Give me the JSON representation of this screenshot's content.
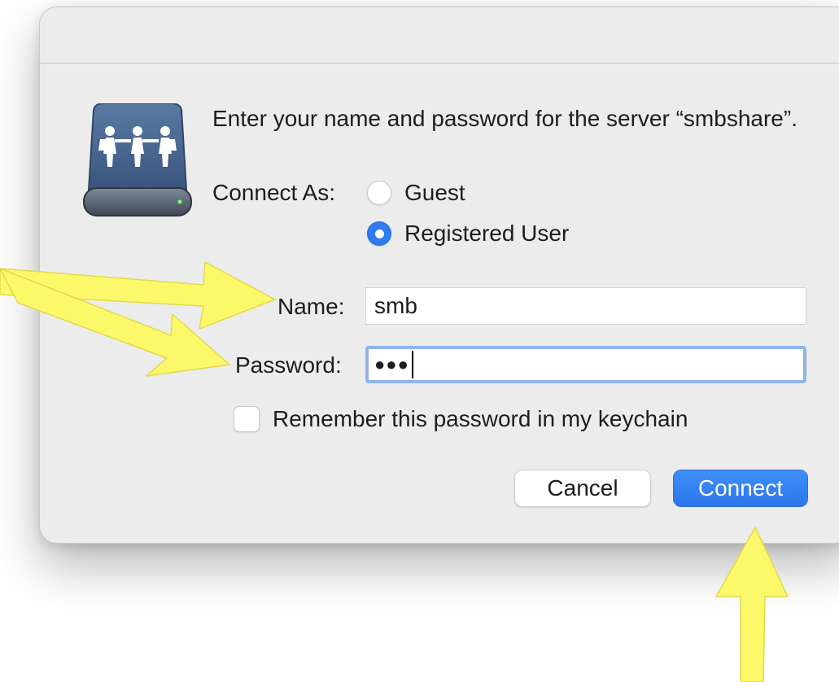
{
  "dialog": {
    "prompt": "Enter your name and password for the server “smbshare”.",
    "server_icon": "shared-server-drive-icon"
  },
  "connect_as": {
    "label": "Connect As:",
    "options": [
      {
        "label": "Guest",
        "selected": false
      },
      {
        "label": "Registered User",
        "selected": true
      }
    ]
  },
  "fields": {
    "name_label": "Name:",
    "name_value": "smb",
    "password_label": "Password:",
    "password_dots": "●●●"
  },
  "keychain": {
    "label": "Remember this password in my keychain",
    "checked": false
  },
  "buttons": {
    "cancel": "Cancel",
    "connect": "Connect"
  },
  "colors": {
    "accent": "#2f7bf0",
    "focus_ring": "#8fb4ea",
    "annotation_arrow": "#fbf96a"
  }
}
